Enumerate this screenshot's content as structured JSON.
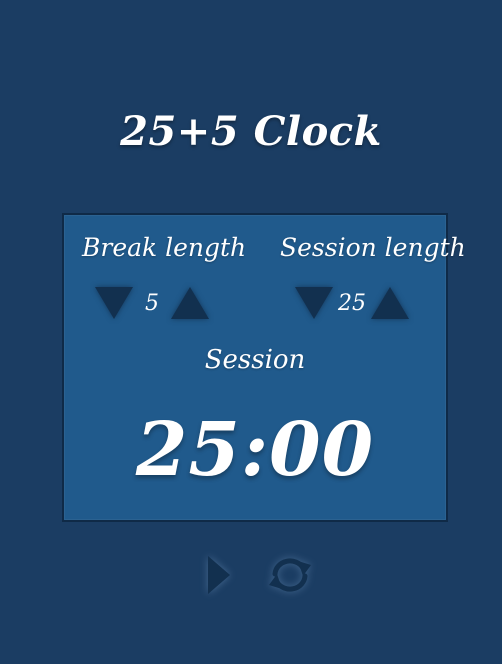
{
  "app": {
    "title": "25+5 Clock"
  },
  "break": {
    "label": "Break length",
    "value": "5"
  },
  "session": {
    "label": "Session length",
    "value": "25"
  },
  "timer": {
    "label": "Session",
    "time_left": "25:00"
  },
  "icons": {
    "decrement": "triangle-down-icon",
    "increment": "triangle-up-icon",
    "play": "play-icon",
    "reset": "refresh-icon"
  },
  "colors": {
    "background": "#1b3d63",
    "panel": "#205a8c",
    "panel_border": "#0f2a47",
    "arrow": "#12304f",
    "text": "#ffffff"
  }
}
